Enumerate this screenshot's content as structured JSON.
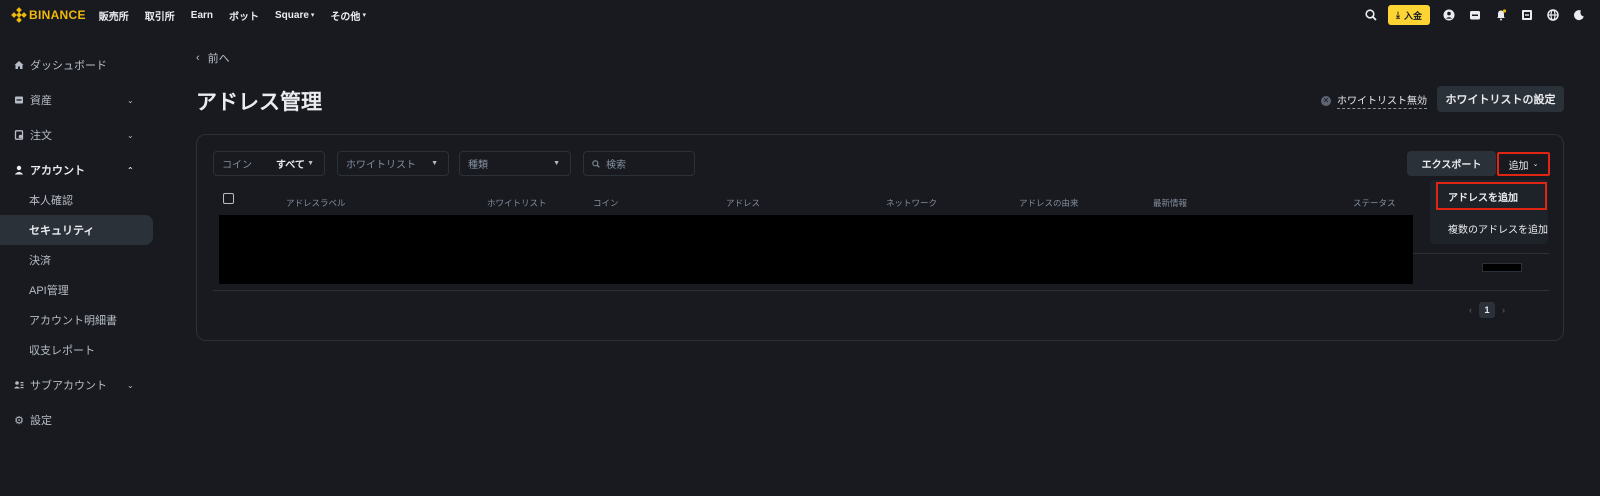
{
  "brand": {
    "name": "BINANCE",
    "color": "#f0b90b"
  },
  "nav": {
    "items": [
      {
        "label": "販売所",
        "dropdown": false
      },
      {
        "label": "取引所",
        "dropdown": false
      },
      {
        "label": "Earn",
        "dropdown": false
      },
      {
        "label": "ボット",
        "dropdown": false
      },
      {
        "label": "Square",
        "dropdown": true
      },
      {
        "label": "その他",
        "dropdown": true
      }
    ],
    "deposit_label": "入金",
    "right_icons": [
      "search-icon",
      "user-icon",
      "wallet-icon",
      "bell-icon",
      "scan-icon",
      "globe-icon",
      "moon-icon"
    ]
  },
  "sidebar": {
    "dashboard": "ダッシュボード",
    "assets": "資産",
    "orders": "注文",
    "account": "アカウント",
    "account_sub": [
      "本人確認",
      "セキュリティ",
      "決済",
      "API管理",
      "アカウント明細書",
      "収支レポート"
    ],
    "subaccount": "サブアカウント",
    "settings": "設定"
  },
  "main": {
    "back_label": "前へ",
    "title": "アドレス管理",
    "whitelist_status": "ホワイトリスト無効",
    "whitelist_settings": "ホワイトリストの設定",
    "filters": {
      "coin_label": "コイン",
      "coin_value": "すべて",
      "whitelist_label": "ホワイトリスト",
      "type_label": "種類",
      "search_placeholder": "検索"
    },
    "export_label": "エクスポート",
    "add_label": "追加",
    "columns": [
      "アドレスラベル",
      "ホワイトリスト",
      "コイン",
      "アドレス",
      "ネットワーク",
      "アドレスの由来",
      "最新情報",
      "ステータス"
    ],
    "pagination": {
      "current": "1"
    },
    "dropdown": {
      "add_address": "アドレスを追加",
      "add_multiple": "複数のアドレスを追加"
    }
  },
  "colors": {
    "accent": "#fcd535",
    "highlight": "#e02514",
    "background": "#181a20"
  }
}
